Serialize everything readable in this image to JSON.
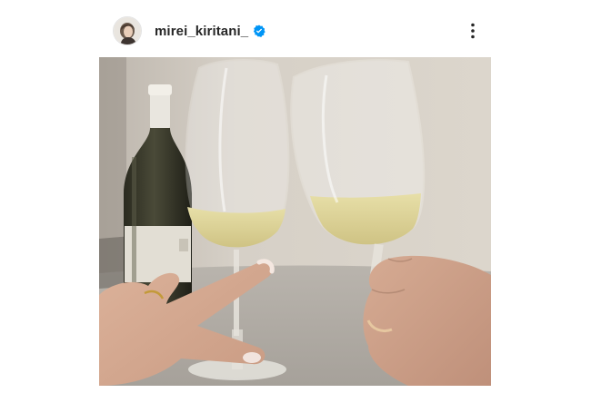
{
  "post": {
    "username": "mirei_kiritani_",
    "verified": true,
    "icons": {
      "avatar": "profile-photo",
      "verified": "verified-badge-icon",
      "more": "more-options-icon"
    },
    "colors": {
      "verified_badge": "#0095f6",
      "username_text": "#262626"
    }
  }
}
